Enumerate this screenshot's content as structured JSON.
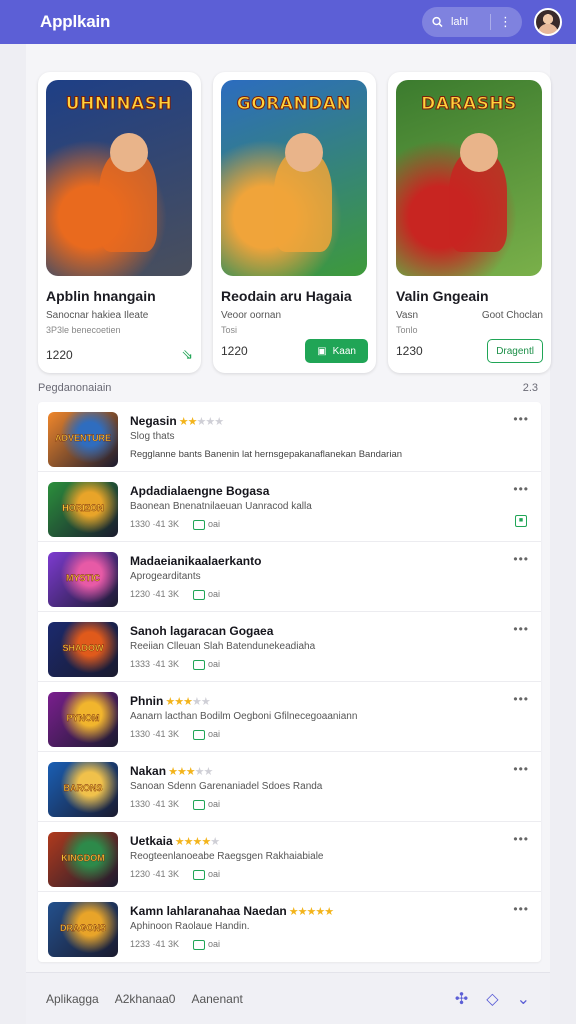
{
  "app": {
    "title": "Applkain"
  },
  "search": {
    "label": "lahl"
  },
  "featured": [
    {
      "art_label": "UHNINASH",
      "title": "Apblin hnangain",
      "sub_left": "Sanocnar hakiea Ileate",
      "sub_right": "",
      "sub2": "3P3le benecoetien",
      "price": "1220",
      "action": "",
      "action_type": "icon",
      "colors": [
        "#1e3f86",
        "#e96a1e",
        "#4a4f5c"
      ]
    },
    {
      "art_label": "GORANDAN",
      "title": "Reodain aru Hagaia",
      "sub_left": "Veoor oornan",
      "sub_right": "",
      "sub2": "Tosi",
      "price": "1220",
      "action": "Kaan",
      "action_type": "solid",
      "colors": [
        "#2c6cbf",
        "#f0a43a",
        "#3e9a3a"
      ]
    },
    {
      "art_label": "DARASHS",
      "title": "Valin Gngeain",
      "sub_left": "Vasn",
      "sub_right": "Goot Choclan",
      "sub2": "Tonlo",
      "price": "1230",
      "action": "Dragentl",
      "action_type": "outline",
      "colors": [
        "#3b7b2e",
        "#c82521",
        "#7ab04a"
      ]
    }
  ],
  "section": {
    "title": "Pegdanonaiain",
    "right": "2.3"
  },
  "list": [
    {
      "title": "Negasin",
      "stars": 2,
      "sub": "Slog thats",
      "meta": "Regglanne bants Banenin lat hernsgepakanaflanekan Bandarian",
      "desc": true,
      "thumb": "ADVENTURE",
      "colors": [
        "#f0872b",
        "#2f6dbf"
      ]
    },
    {
      "title": "Apdadialaengne Bogasa",
      "stars": 0,
      "sub": "Baonean Bnenatnilaeuan Uanracod kalla",
      "meta": "1330  ·41 3K",
      "desc": false,
      "thumb": "HORIZON",
      "colors": [
        "#2b8f3c",
        "#e8a429"
      ]
    },
    {
      "title": "Madaeianikaalaerkanto",
      "stars": 0,
      "sub": "Aprogearditants",
      "meta": "1230  ·41 3K",
      "desc": false,
      "thumb": "MYSTIC",
      "colors": [
        "#7d3bd0",
        "#e75aa6"
      ]
    },
    {
      "title": "Sanoh lagaracan Gogaea",
      "stars": 0,
      "sub": "Reeiian Clleuan Slah Batendunekeadiaha",
      "meta": "1333  ·41 3K",
      "desc": false,
      "thumb": "SHADOW",
      "colors": [
        "#1b2a6e",
        "#e05a1b"
      ]
    },
    {
      "title": "Phnin",
      "stars": 3,
      "sub": "Aanarn lacthan Bodilm Oegboni Gfilnecegoaaniann",
      "meta": "1330  ·41 3K",
      "desc": false,
      "thumb": "PYNOM",
      "colors": [
        "#7a1f8e",
        "#f1b52d"
      ]
    },
    {
      "title": "Nakan",
      "stars": 3,
      "sub": "Sanoan Sdenn Garenaniadel Sdoes Randa",
      "meta": "1330  ·41 3K",
      "desc": false,
      "thumb": "BARONS",
      "colors": [
        "#1a5fb4",
        "#f0c14b"
      ]
    },
    {
      "title": "Uetkaia",
      "stars": 4,
      "sub": "Reogteenlanoeabe Raegsgen Rakhaiabiale",
      "meta": "1230  ·41 3K",
      "desc": false,
      "thumb": "KINGDOM",
      "colors": [
        "#b03a1d",
        "#2d8a4a"
      ]
    },
    {
      "title": "Kamn lahlaranahaa Naedan",
      "stars": 5,
      "sub": "Aphinoon",
      "meta": "1233  ·41 3K",
      "desc": false,
      "thumb": "DRAGONS",
      "colors": [
        "#23508c",
        "#e8a429"
      ]
    }
  ],
  "list_sub_tail": [
    "",
    "",
    "",
    "",
    "",
    "",
    "",
    "Raolaue Handin."
  ],
  "bottom": {
    "left": "Aplikagga",
    "middle": "A2khanaa0",
    "right": "Aanenant"
  }
}
